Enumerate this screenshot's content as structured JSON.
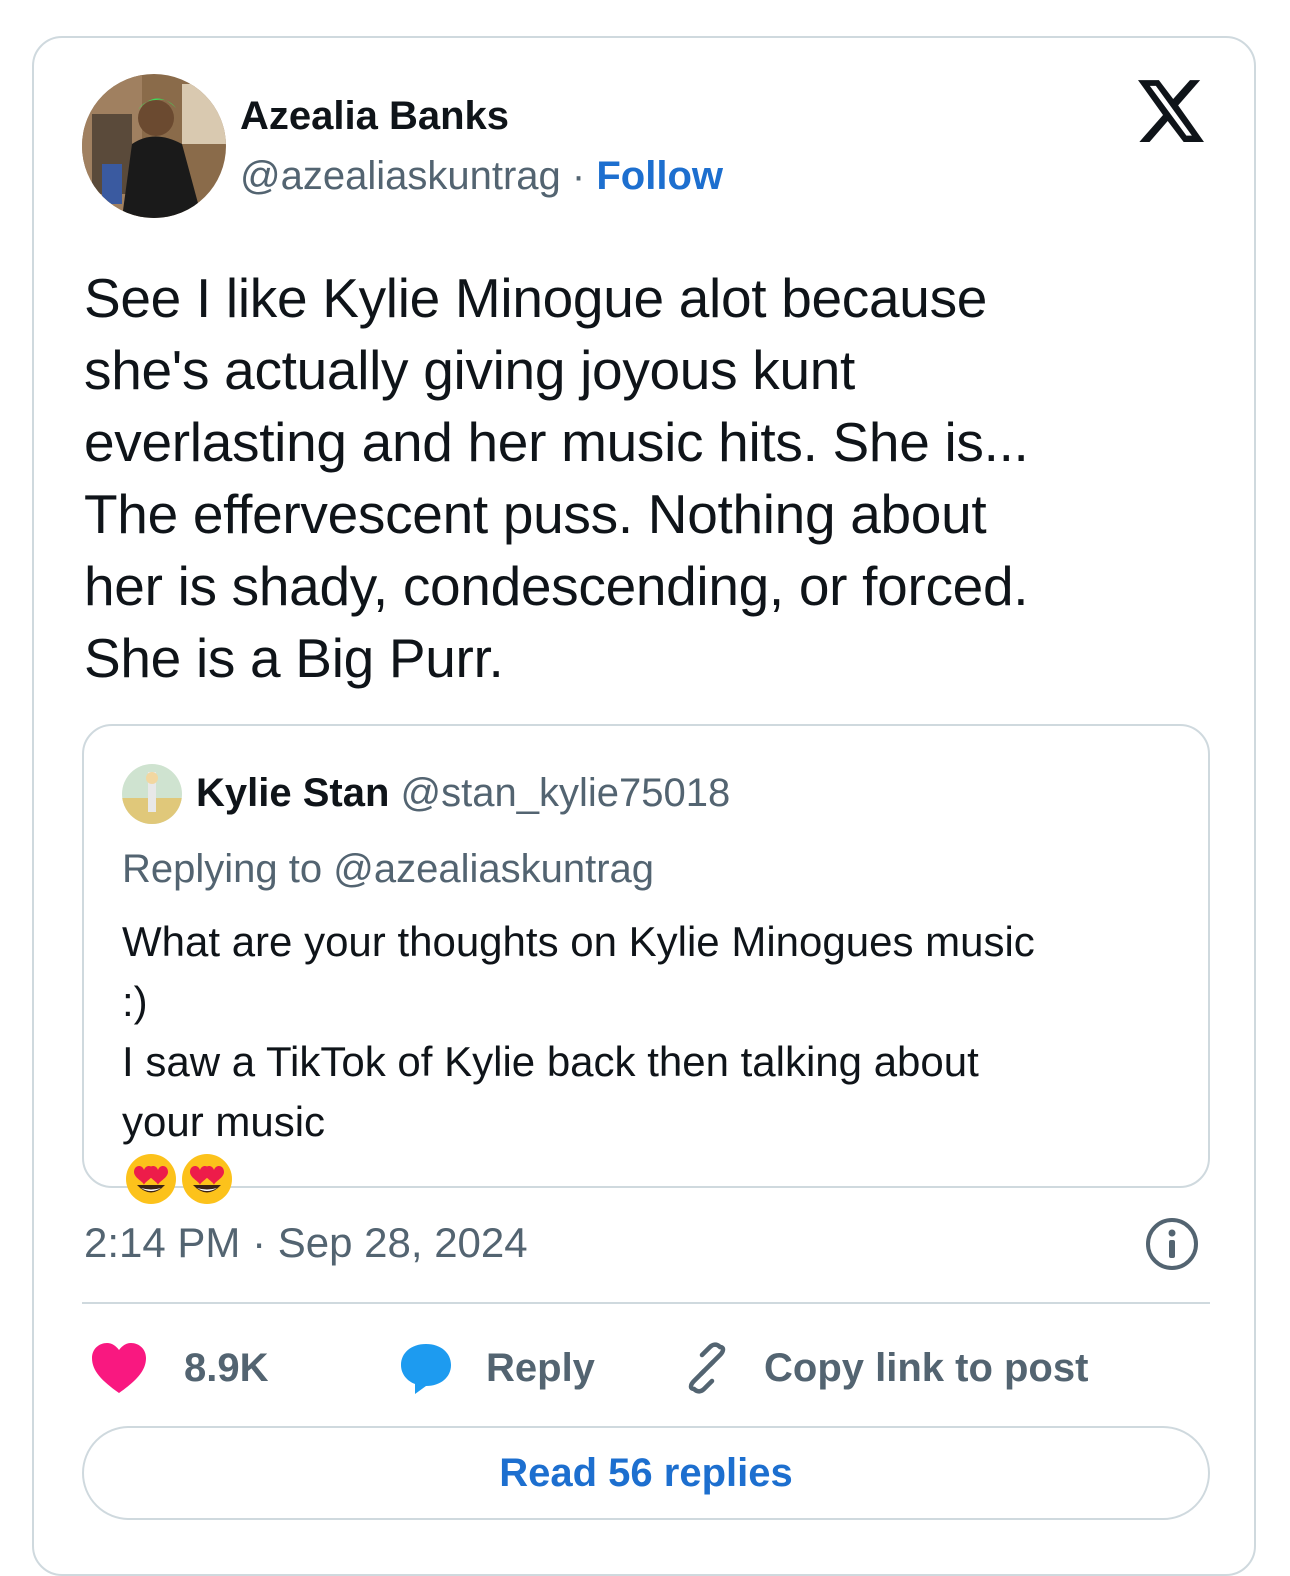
{
  "author": {
    "name": "Azealia Banks",
    "handle": "@azealiaskuntrag",
    "separator": "·",
    "follow_label": "Follow"
  },
  "tweet": {
    "lines": [
      "See I like Kylie Minogue alot because",
      "she's actually giving joyous kunt",
      "everlasting and her music hits. She is...",
      "The effervescent puss. Nothing about",
      "her is shady, condescending,  or forced.",
      "She is a Big Purr."
    ]
  },
  "quoted": {
    "name": "Kylie Stan",
    "handle": "@stan_kylie75018",
    "replying_to": "Replying to @azealiaskuntrag",
    "lines": [
      "What are your thoughts on Kylie Minogues music",
      ":)",
      "I saw a TikTok of Kylie back then talking about",
      "your music"
    ],
    "emojis": [
      "heart-eyes-emoji",
      "heart-eyes-emoji"
    ]
  },
  "meta": {
    "timestamp": "2:14 PM · Sep 28, 2024"
  },
  "actions": {
    "like_count": "8.9K",
    "reply_label": "Reply",
    "copy_label": "Copy link to post"
  },
  "read_replies_label": "Read 56 replies",
  "icons": [
    "x-logo-icon",
    "info-icon",
    "heart-icon",
    "reply-bubble-icon",
    "link-icon"
  ],
  "colors": {
    "accent": "#1d6fcf",
    "like": "#f91880",
    "reply": "#1d9bf0",
    "muted": "#536471",
    "border": "#cfd9de"
  }
}
